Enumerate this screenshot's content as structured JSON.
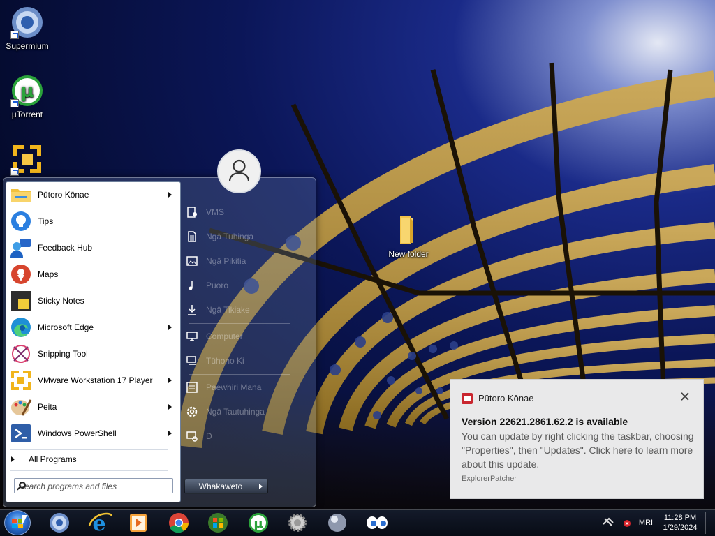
{
  "desktop": {
    "icons": [
      {
        "label": "Supermium",
        "icon": "supermium-icon"
      },
      {
        "label": "µTorrent",
        "icon": "utorrent-icon"
      },
      {
        "label": "",
        "icon": "vmware-icon"
      },
      {
        "label": "New folder",
        "icon": "folder-icon"
      }
    ]
  },
  "start_menu": {
    "items": [
      {
        "label": "Pūtoro Kōnae",
        "icon": "file-explorer-icon",
        "has_submenu": true
      },
      {
        "label": "Tips",
        "icon": "tips-icon",
        "has_submenu": false
      },
      {
        "label": "Feedback Hub",
        "icon": "feedback-hub-icon",
        "has_submenu": false
      },
      {
        "label": "Maps",
        "icon": "maps-icon",
        "has_submenu": false
      },
      {
        "label": "Sticky Notes",
        "icon": "sticky-notes-icon",
        "has_submenu": false
      },
      {
        "label": "Microsoft Edge",
        "icon": "edge-icon",
        "has_submenu": true
      },
      {
        "label": "Snipping Tool",
        "icon": "snipping-tool-icon",
        "has_submenu": false
      },
      {
        "label": "VMware Workstation 17 Player",
        "icon": "vmware-icon",
        "has_submenu": true
      },
      {
        "label": "Peita",
        "icon": "paint-icon",
        "has_submenu": true
      },
      {
        "label": "Windows PowerShell",
        "icon": "powershell-icon",
        "has_submenu": true
      }
    ],
    "all_programs": "All Programs",
    "search_placeholder": "Search programs and files",
    "right_items": [
      {
        "label": "VMS",
        "icon": "user-folder-icon"
      },
      {
        "label": "Ngā Tuhinga",
        "icon": "documents-icon"
      },
      {
        "label": "Ngā Pikitia",
        "icon": "pictures-icon"
      },
      {
        "label": "Puoro",
        "icon": "music-icon"
      },
      {
        "label": "Ngā Tikiake",
        "icon": "downloads-icon"
      },
      {
        "label": "Computer",
        "icon": "computer-icon"
      },
      {
        "label": "Tūhono Ki",
        "icon": "connect-to-icon"
      },
      {
        "label": "Paewhiri Mana",
        "icon": "control-panel-icon"
      },
      {
        "label": "Ngā Tautuhinga",
        "icon": "settings-icon"
      },
      {
        "label": "D",
        "icon": "devices-icon"
      }
    ],
    "shutdown_label": "Whakaweto"
  },
  "notification": {
    "app_name": "Pūtoro Kōnae",
    "title": "Version 22621.2861.62.2 is available",
    "body": "You can update by right clicking the taskbar, choosing \"Properties\", then \"Updates\". Click here to learn more about this update.",
    "attribution": "ExplorerPatcher"
  },
  "taskbar": {
    "pinned": [
      {
        "icon": "supermium-icon"
      },
      {
        "icon": "internet-explorer-icon"
      },
      {
        "icon": "media-player-icon"
      },
      {
        "icon": "chrome-icon"
      },
      {
        "icon": "windows-xp-icon"
      },
      {
        "icon": "utorrent-icon"
      },
      {
        "icon": "gear-burst-icon"
      },
      {
        "icon": "orb-icon"
      },
      {
        "icon": "eyes-icon"
      }
    ],
    "language": "MRI",
    "time": "11:28 PM",
    "date": "1/29/2024"
  }
}
